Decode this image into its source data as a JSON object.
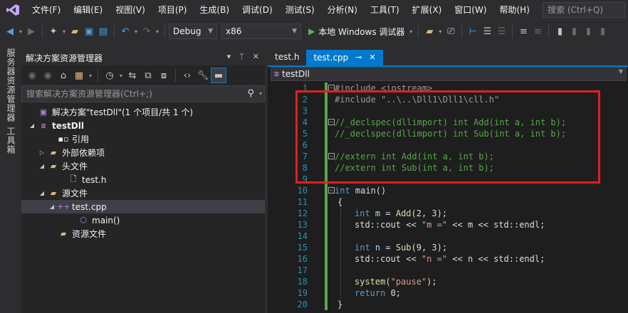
{
  "menu": {
    "items": [
      "文件(F)",
      "编辑(E)",
      "视图(V)",
      "项目(P)",
      "生成(B)",
      "调试(D)",
      "测试(S)",
      "分析(N)",
      "工具(T)",
      "扩展(X)",
      "窗口(W)",
      "帮助(H)"
    ],
    "search_placeholder": "搜索 (Ctrl+Q)"
  },
  "toolbar": {
    "config": "Debug",
    "platform": "x86",
    "run_label": "本地 Windows 调试器"
  },
  "side_tabs": {
    "server_explorer": "服务器资源管理器",
    "toolbox": "工具箱"
  },
  "solution_explorer": {
    "title": "解决方案资源管理器",
    "search_placeholder": "搜索解决方案资源管理器(Ctrl+;)",
    "tree": {
      "solution": "解决方案\"testDll\"(1 个项目/共 1 个)",
      "project": "testDll",
      "references": "引用",
      "external_deps": "外部依赖项",
      "header_files": "头文件",
      "test_h": "test.h",
      "source_files": "源文件",
      "test_cpp": "test.cpp",
      "main_fn": "main()",
      "resource_files": "资源文件"
    }
  },
  "editor": {
    "tabs": [
      "test.h",
      "test.cpp"
    ],
    "active_tab": "test.cpp",
    "nav_scope": "testDll",
    "line_numbers": [
      "1",
      "2",
      "3",
      "4",
      "5",
      "6",
      "7",
      "8",
      "9",
      "10",
      "11",
      "12",
      "13",
      "14",
      "15",
      "16",
      "17",
      "18",
      "19",
      "20"
    ],
    "code": {
      "l1": "#include <iostream>",
      "l2": "#include \"..\\..\\Dll1\\Dll1\\cll.h\"",
      "l4": "//_declspec(dllimport) int Add(int a, int b);",
      "l5": "//_declspec(dllimport) int Sub(int a, int b);",
      "l7": "//extern int Add(int a, int b);",
      "l8": "//extern int Sub(int a, int b);",
      "l10_kw": "int",
      "l10_rest": " main()",
      "l11": "{",
      "l12_kw": "int",
      "l12_var": "m",
      "l12_mid": " = ",
      "l12_fn": "Add",
      "l12_args": "(2, 3);",
      "l13_a": "std::cout << ",
      "l13_str": "\"m =\"",
      "l13_b": " << m << std::endl;",
      "l15_kw": "int",
      "l15_var": "n",
      "l15_mid": " = ",
      "l15_fn": "Sub",
      "l15_args": "(9, 3);",
      "l16_a": "std::cout << ",
      "l16_str": "\"n =\"",
      "l16_b": " << n << std::endl;",
      "l18_fn": "system",
      "l18_open": "(",
      "l18_str": "\"pause\"",
      "l18_close": ");",
      "l19_kw": "return",
      "l19_rest": " 0;",
      "l20": "}"
    }
  },
  "colors": {
    "accent": "#007acc",
    "highlight_box": "#e02020",
    "change_bar": "#57a64a"
  }
}
